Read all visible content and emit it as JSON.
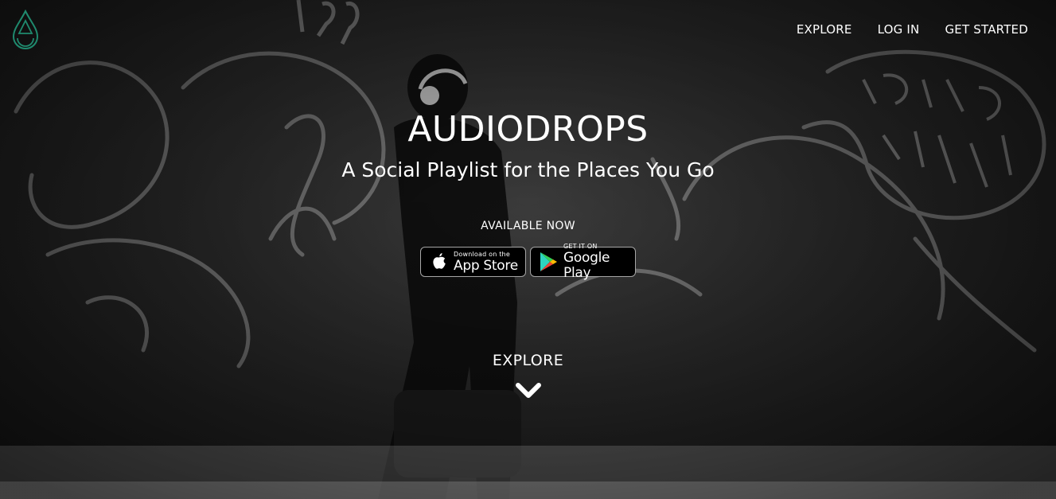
{
  "brand": {
    "logo_icon": "drop-logo-icon",
    "accent_color": "#1f8a6e"
  },
  "nav": {
    "items": [
      {
        "label": "EXPLORE"
      },
      {
        "label": "LOG IN"
      },
      {
        "label": "GET STARTED"
      }
    ]
  },
  "hero": {
    "title": "AUDIODROPS",
    "subtitle": "A Social Playlist for the Places You Go",
    "available": "AVAILABLE NOW",
    "app_store": {
      "small": "Download on the",
      "big": "App Store",
      "icon": "apple-icon"
    },
    "google_play": {
      "small": "GET IT ON",
      "big": "Google Play",
      "icon": "google-play-icon"
    },
    "explore": "EXPLORE",
    "chevron_icon": "chevron-down-icon"
  }
}
